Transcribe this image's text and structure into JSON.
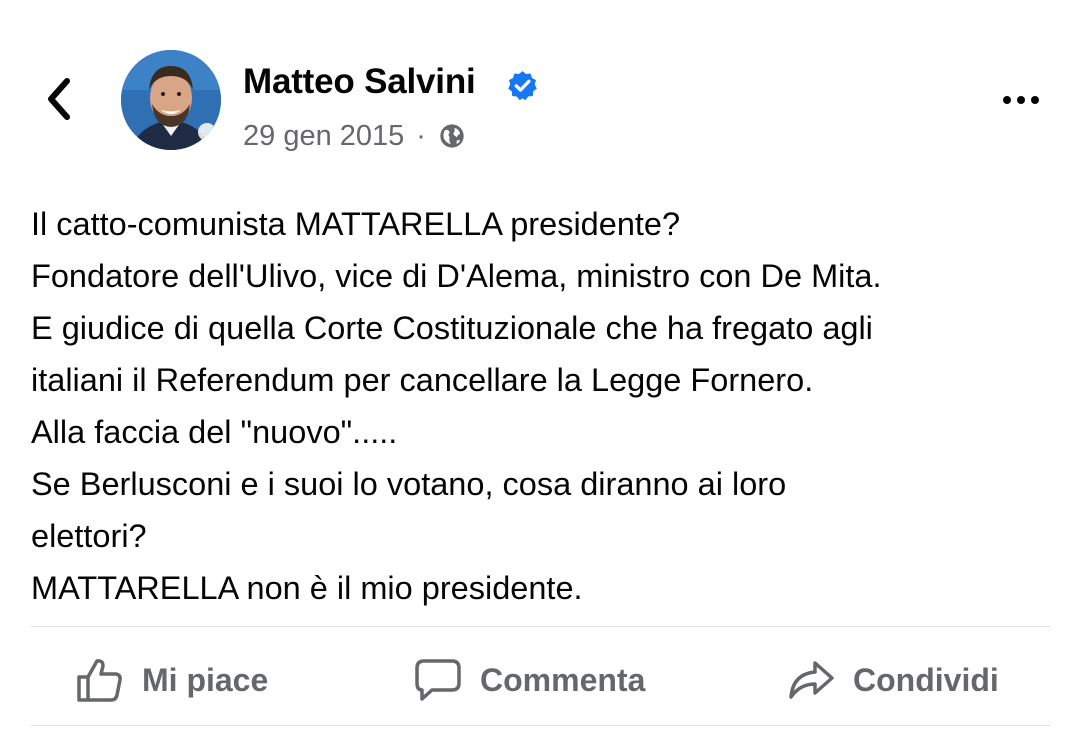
{
  "header": {
    "back_icon": "chevron-left-icon",
    "author_name": "Matteo Salvini",
    "verified_icon": "verified-badge-icon",
    "date": "29 gen 2015",
    "separator": "·",
    "audience_icon": "globe-icon",
    "more_icon": "ellipsis-icon"
  },
  "post": {
    "lines": [
      "Il catto-comunista MATTARELLA presidente?",
      "Fondatore dell'Ulivo, vice di D'Alema, ministro con De Mita.",
      "E giudice di quella Corte Costituzionale che ha fregato agli",
      "italiani il Referendum per cancellare la Legge Fornero.",
      "Alla faccia del \"nuovo\".....",
      "Se Berlusconi e i suoi lo votano, cosa diranno ai loro",
      "elettori?",
      "MATTARELLA non è il mio presidente."
    ]
  },
  "actions": {
    "like_label": "Mi piace",
    "comment_label": "Commenta",
    "share_label": "Condividi",
    "like_icon": "thumbs-up-icon",
    "comment_icon": "comment-icon",
    "share_icon": "share-icon"
  },
  "colors": {
    "text": "#050505",
    "secondary_text": "#65676b",
    "verified_blue": "#1877f2",
    "divider": "#dadde1"
  }
}
